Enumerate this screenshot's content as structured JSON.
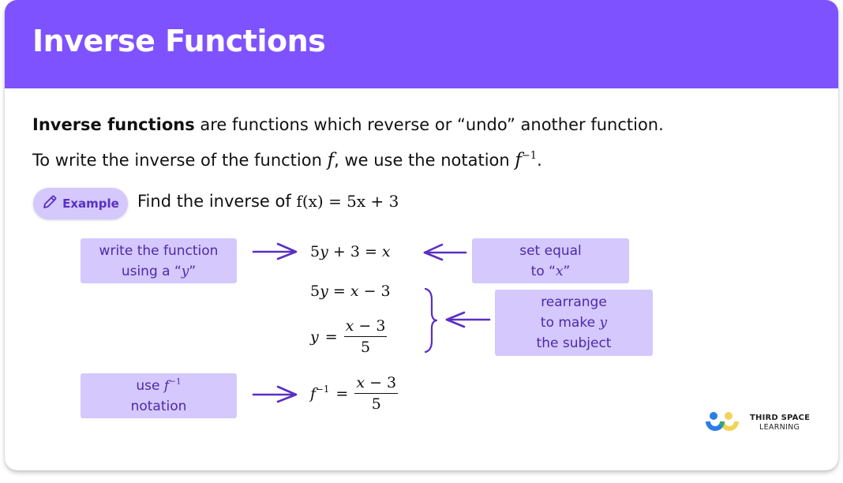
{
  "header": {
    "title": "Inverse Functions"
  },
  "colors": {
    "header_bg": "#7f52ff",
    "box_bg": "#d4c8fd",
    "accent_text": "#4d2aa6",
    "arrow": "#5a2fc2"
  },
  "intro": {
    "line1_bold": "Inverse functions",
    "line1_rest": " are functions which reverse or “undo” another function.",
    "line2_before": "To write the inverse of the function ",
    "line2_f": "f",
    "line2_middle": ", we use the notation ",
    "line2_notation_base": "f",
    "line2_notation_sup": "−1",
    "line2_end": "."
  },
  "example": {
    "badge_label": "Example",
    "badge_icon": "pencil-icon",
    "question_text": "Find the inverse of ",
    "question_math": "f(x) = 5x + 3"
  },
  "steps": {
    "box1": {
      "line1": "write the function",
      "line2_prefix": "using a “",
      "line2_var": "y",
      "line2_suffix": "”"
    },
    "box2": {
      "line1": "set equal",
      "line2_prefix": "to “",
      "line2_var": "x",
      "line2_suffix": "”"
    },
    "box3": {
      "line1": "rearrange",
      "line2_prefix": "to make ",
      "line2_var": "y",
      "line3": "the subject"
    },
    "box4": {
      "line1_prefix": "use ",
      "line1_var": "f",
      "line1_sup": "−1",
      "line2": "notation"
    }
  },
  "equations": {
    "eq1": {
      "a": "5",
      "b": "y",
      "c": " + 3 = ",
      "d": "x"
    },
    "eq2": {
      "a": "5",
      "b": "y",
      "c": " = ",
      "d": "x",
      "e": " − 3"
    },
    "eq3": {
      "lhs_var": "y",
      "eq": "=",
      "num_var": "x",
      "num_rest": " − 3",
      "den": "5"
    },
    "eq4": {
      "lhs_var": "f",
      "lhs_sup": "−1",
      "eq": "=",
      "num_var": "x",
      "num_rest": " − 3",
      "den": "5"
    }
  },
  "logo": {
    "line1": "THIRD SPACE",
    "line2": "LEARNING"
  }
}
